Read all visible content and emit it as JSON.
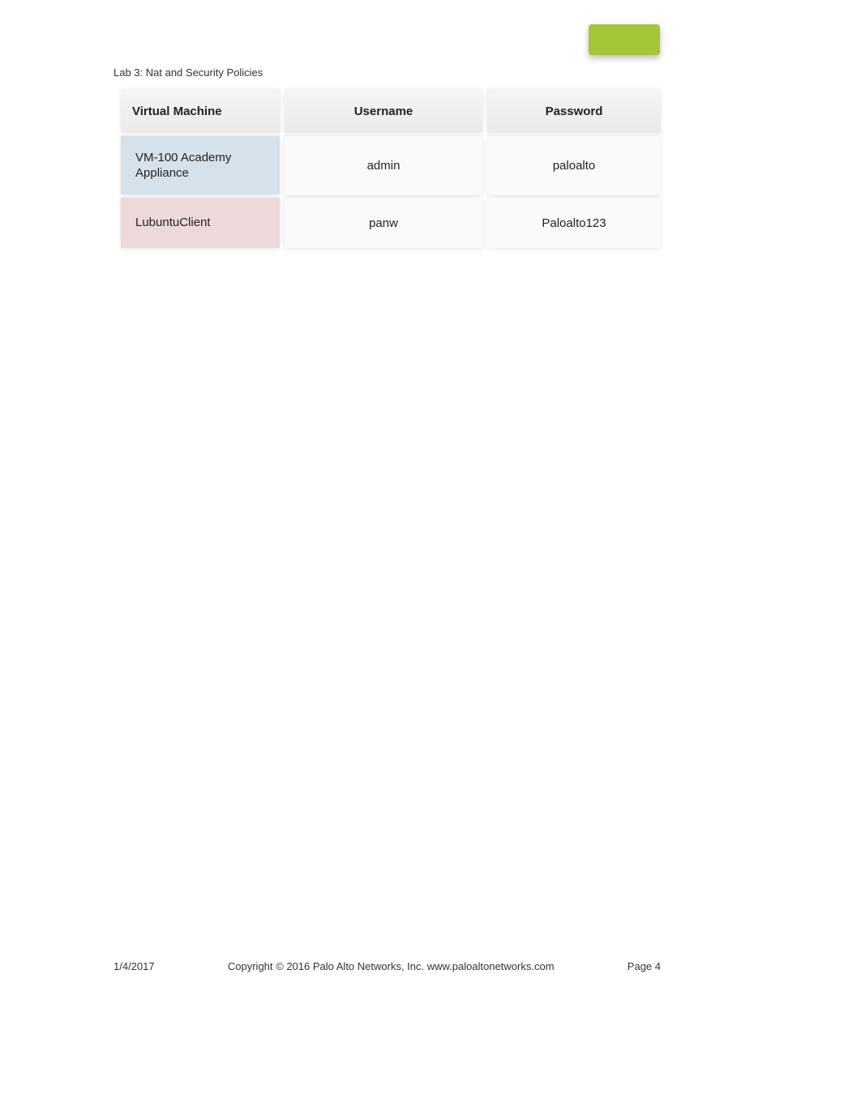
{
  "header": {
    "title": "Lab 3: Nat and Security Policies"
  },
  "table": {
    "columns": {
      "vm": "Virtual Machine",
      "username": "Username",
      "password": "Password"
    },
    "rows": [
      {
        "vm": "VM-100 Academy Appliance",
        "username": "admin",
        "password": "paloalto"
      },
      {
        "vm": "LubuntuClient",
        "username": "panw",
        "password": "Paloalto123"
      }
    ]
  },
  "footer": {
    "date": "1/4/2017",
    "copyright": "Copyright © 2016 Palo Alto Networks, Inc. www.paloaltonetworks.com",
    "page": "Page 4"
  }
}
